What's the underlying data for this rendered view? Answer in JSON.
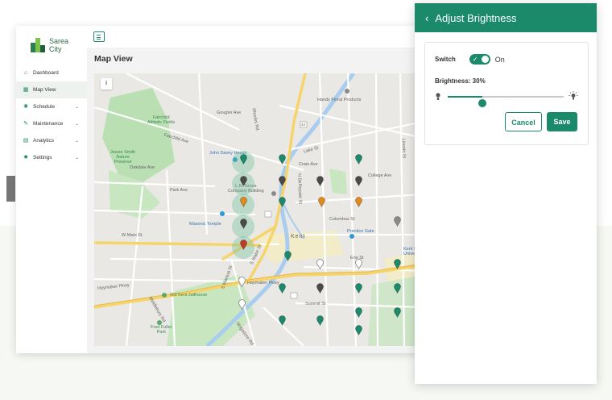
{
  "brand": {
    "name_line1": "Sarea",
    "name_line2": "City"
  },
  "sidebar": {
    "items": [
      {
        "label": "Dashboard",
        "icon": "home-icon",
        "glyph": "⌂",
        "has_chevron": false,
        "active": false
      },
      {
        "label": "Map View",
        "icon": "map-icon",
        "glyph": "▦",
        "has_chevron": false,
        "active": true
      },
      {
        "label": "Schedule",
        "icon": "sun-icon",
        "glyph": "✺",
        "has_chevron": true,
        "active": false
      },
      {
        "label": "Maintenance",
        "icon": "wrench-icon",
        "glyph": "✎",
        "has_chevron": true,
        "active": false
      },
      {
        "label": "Analytics",
        "icon": "chart-icon",
        "glyph": "▤",
        "has_chevron": true,
        "active": false
      },
      {
        "label": "Settings",
        "icon": "gear-icon",
        "glyph": "✹",
        "has_chevron": true,
        "active": false
      }
    ]
  },
  "main": {
    "title": "Map View"
  },
  "map": {
    "labels": {
      "fairchild": "Fairchild\nAthletic Fields",
      "fairchild_ave": "Fairchild Ave",
      "handy_floral": "Handy Floral Products",
      "john_davey": "John Davey House",
      "jessie_smith": "Jessie Smith\nNature\nPreserve",
      "ln_gross": "L.N. Gross\nCompany Building",
      "masonic": "Masonic Temple",
      "w_main": "W Main St",
      "kent": "Kent",
      "prentice": "Prentice Gate",
      "kent_state": "Kent St\nUnive",
      "haymaker_w": "Haymaker Pkwy",
      "haymaker_e": "Haymaker Pkwy",
      "jailhouse": "Old Kent Jailhouse",
      "fred_fuller": "Fred Fuller\nPark",
      "summit": "Summit St",
      "lake": "Lake St",
      "oakdale": "Oakdale Ave",
      "park": "Park Ave",
      "crain": "Crain Ave",
      "middlebury": "Middlebury Rd",
      "mantua": "S Mantua St",
      "water": "S Water St",
      "gougler": "Gougler Ave",
      "rhodes": "Rhodes Rd",
      "route43": "43",
      "columbus": "Columbus St",
      "depeyster": "N DePeyster St",
      "mogadore": "Mogadore Rd",
      "college": "College Ave",
      "lincoln": "Lincoln St",
      "erie": "Erie St"
    }
  },
  "panel": {
    "title": "Adjust Brightness",
    "switch_label": "Switch",
    "switch_state": "On",
    "switch_on": true,
    "brightness_label": "Brightness: 30%",
    "brightness_value": 0.3,
    "cancel_label": "Cancel",
    "save_label": "Save",
    "accent": "#1a8a6b"
  },
  "colors": {
    "accent": "#1a8a6b",
    "pin_teal": "#1a8a6b",
    "pin_dark": "#4a4a4a",
    "pin_orange": "#e08a1e",
    "pin_red": "#c0392b",
    "pin_gray": "#8a8a8a",
    "road_major": "#f7d46a"
  }
}
